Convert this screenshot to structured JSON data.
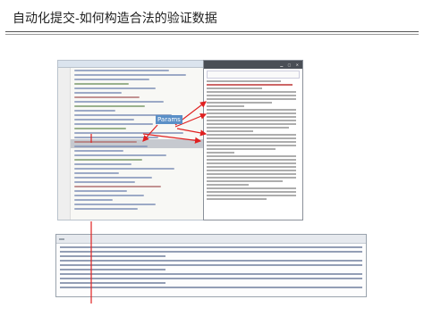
{
  "slide": {
    "title": "自动化提交-如何构造合法的验证数据",
    "annotation_label": "Params"
  },
  "editor": {
    "title": "",
    "code_lines": [
      "",
      "",
      "",
      ""
    ]
  },
  "browser": {
    "title": "",
    "url": "",
    "content_lines": [
      "",
      "",
      ""
    ]
  },
  "devtools": {
    "toolbar_items": [
      "",
      "",
      "",
      "",
      "",
      ""
    ],
    "log_lines": [
      "",
      "",
      "",
      ""
    ]
  },
  "colors": {
    "annotation_red": "#e02020",
    "annotation_blue": "#5a8fc7"
  }
}
